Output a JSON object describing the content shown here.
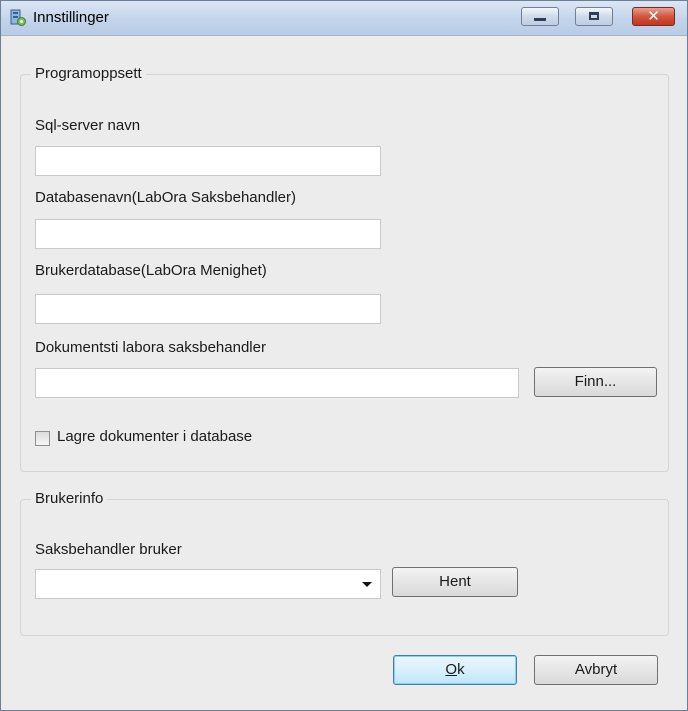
{
  "window": {
    "title": "Innstillinger"
  },
  "icons": {
    "app": "settings-app-icon",
    "minimize": "minimize-icon",
    "maximize": "maximize-icon",
    "close": "close-icon"
  },
  "program_setup": {
    "legend": "Programoppsett",
    "sql_server_label": "Sql-server navn",
    "sql_server_value": "",
    "database_label": "Databasenavn(LabOra Saksbehandler)",
    "database_value": "",
    "user_db_label": "Brukerdatabase(LabOra Menighet)",
    "user_db_value": "",
    "doc_path_label": "Dokumentsti labora saksbehandler",
    "doc_path_value": "",
    "browse_button": "Finn...",
    "store_docs_label": "Lagre dokumenter i database",
    "store_docs_checked": false
  },
  "user_info": {
    "legend": "Brukerinfo",
    "handler_label": "Saksbehandler bruker",
    "handler_value": "",
    "fetch_button": "Hent"
  },
  "footer": {
    "ok_mnemonic": "O",
    "ok_rest": "k",
    "cancel_button": "Avbryt"
  }
}
